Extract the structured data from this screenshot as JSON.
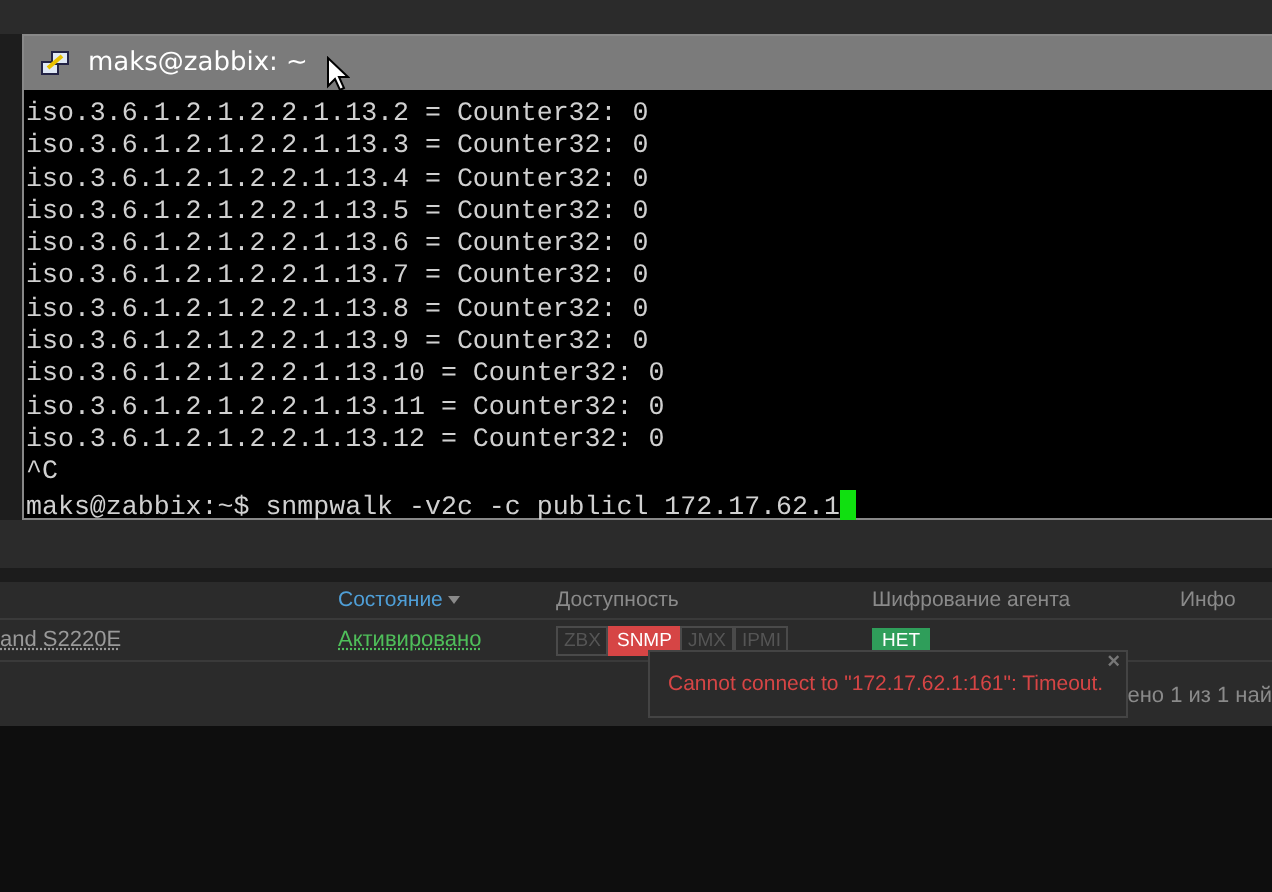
{
  "terminal": {
    "title": "maks@zabbix: ~",
    "lines": [
      "iso.3.6.1.2.1.2.2.1.13.2 = Counter32: 0",
      "iso.3.6.1.2.1.2.2.1.13.3 = Counter32: 0",
      "iso.3.6.1.2.1.2.2.1.13.4 = Counter32: 0",
      "iso.3.6.1.2.1.2.2.1.13.5 = Counter32: 0",
      "iso.3.6.1.2.1.2.2.1.13.6 = Counter32: 0",
      "iso.3.6.1.2.1.2.2.1.13.7 = Counter32: 0",
      "iso.3.6.1.2.1.2.2.1.13.8 = Counter32: 0",
      "iso.3.6.1.2.1.2.2.1.13.9 = Counter32: 0",
      "iso.3.6.1.2.1.2.2.1.13.10 = Counter32: 0",
      "iso.3.6.1.2.1.2.2.1.13.11 = Counter32: 0",
      "iso.3.6.1.2.1.2.2.1.13.12 = Counter32: 0",
      "^C"
    ],
    "prompt": "maks@zabbix:~$ snmpwalk -v2c -c publicl 172.17.62.1"
  },
  "table": {
    "columns": [
      {
        "label": "Состояние",
        "sorted": true
      },
      {
        "label": "Доступность",
        "sorted": false
      },
      {
        "label": "Шифрование агента",
        "sorted": false
      },
      {
        "label": "Инфо",
        "sorted": false
      }
    ],
    "row": {
      "name": "and S2220E",
      "status": "Активировано",
      "availability": [
        {
          "label": "ZBX",
          "error": false
        },
        {
          "label": "SNMP",
          "error": true
        },
        {
          "label": "JMX",
          "error": false
        },
        {
          "label": "IPMI",
          "error": false
        }
      ],
      "encryption": "НЕТ"
    }
  },
  "tooltip": {
    "message": "Cannot connect to \"172.17.62.1:161\": Timeout.",
    "close": "×"
  },
  "footer_text": "ено 1 из 1 най"
}
